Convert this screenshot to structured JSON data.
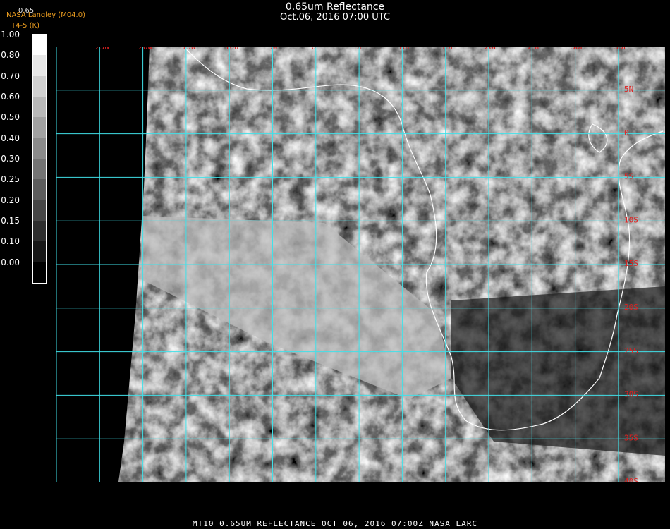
{
  "header": {
    "title": "0.65um Reflectance",
    "datetime": "Oct.06, 2016 07:00 UTC",
    "provider": "NASA Langley (M04.0)",
    "overline": "0.65",
    "product_code": "T4-5 (K)"
  },
  "colorbar": {
    "ticks": [
      "1.00",
      "0.80",
      "0.70",
      "0.60",
      "0.50",
      "0.40",
      "0.30",
      "0.25",
      "0.20",
      "0.15",
      "0.10",
      "0.00"
    ]
  },
  "map": {
    "lon_labels": [
      "25W",
      "20W",
      "15W",
      "10W",
      "5W",
      "0",
      "5E",
      "10E",
      "15E",
      "20E",
      "25E",
      "30E",
      "35E"
    ],
    "lat_labels": [
      "5N",
      "0",
      "5S",
      "10S",
      "15S",
      "20S",
      "25S",
      "30S",
      "35S",
      "40S"
    ],
    "colors": {
      "grid": "#40e0e8",
      "labels": "#e02020",
      "coast": "#ffffff"
    }
  },
  "footer": {
    "line": "MT10  0.65UM REFLECTANCE   OCT 06, 2016 07:00Z   NASA LARC"
  }
}
